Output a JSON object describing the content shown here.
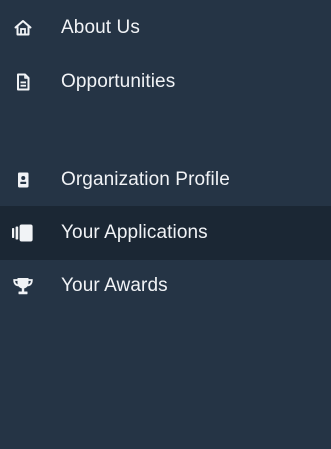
{
  "sidebar": {
    "items": [
      {
        "label": "About Us",
        "icon": "home-icon",
        "active": false
      },
      {
        "label": "Opportunities",
        "icon": "document-icon",
        "active": false
      },
      {
        "label": "Organization Profile",
        "icon": "contact-card-icon",
        "active": false
      },
      {
        "label": "Your Applications",
        "icon": "applications-stack-icon",
        "active": true
      },
      {
        "label": "Your Awards",
        "icon": "trophy-icon",
        "active": false
      }
    ]
  },
  "colors": {
    "background": "#253445",
    "active_background": "#1b2734",
    "text": "#f1f3f6"
  }
}
